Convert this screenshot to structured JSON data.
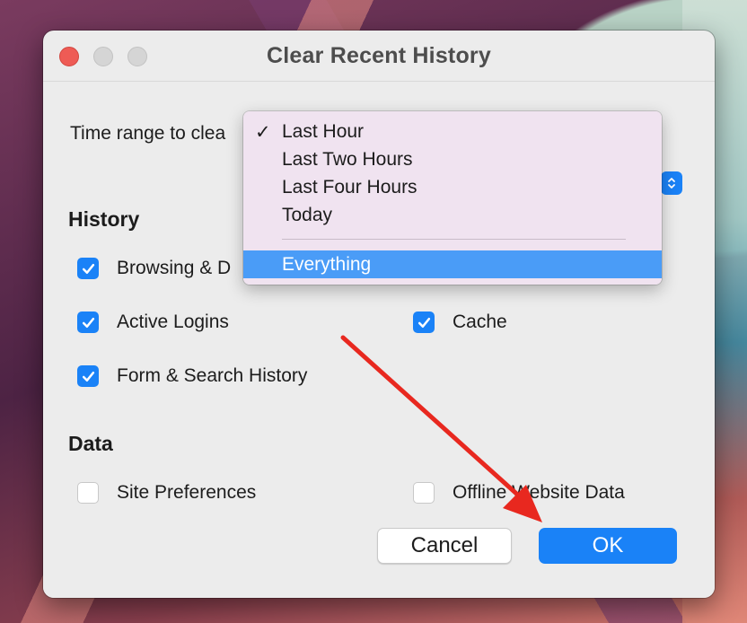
{
  "dialog": {
    "title": "Clear Recent History",
    "time_range_label": "Time range to clea",
    "history_heading": "History",
    "data_heading": "Data"
  },
  "checkboxes": {
    "browsing": {
      "label": "Browsing & D",
      "checked": true
    },
    "active_logins": {
      "label": "Active Logins",
      "checked": true
    },
    "cache": {
      "label": "Cache",
      "checked": true
    },
    "form_search": {
      "label": "Form & Search History",
      "checked": true
    },
    "site_prefs": {
      "label": "Site Preferences",
      "checked": false
    },
    "offline_data": {
      "label": "Offline Website Data",
      "checked": false
    }
  },
  "dropdown": {
    "selected": "Last Hour",
    "checkmark": "✓",
    "items": [
      "Last Hour",
      "Last Two Hours",
      "Last Four Hours",
      "Today",
      "Everything"
    ],
    "highlighted": "Everything"
  },
  "buttons": {
    "cancel": "Cancel",
    "ok": "OK"
  },
  "colors": {
    "accent": "#1a82f7",
    "highlight": "#4a9cf7",
    "annotation_arrow": "#e8281f"
  }
}
